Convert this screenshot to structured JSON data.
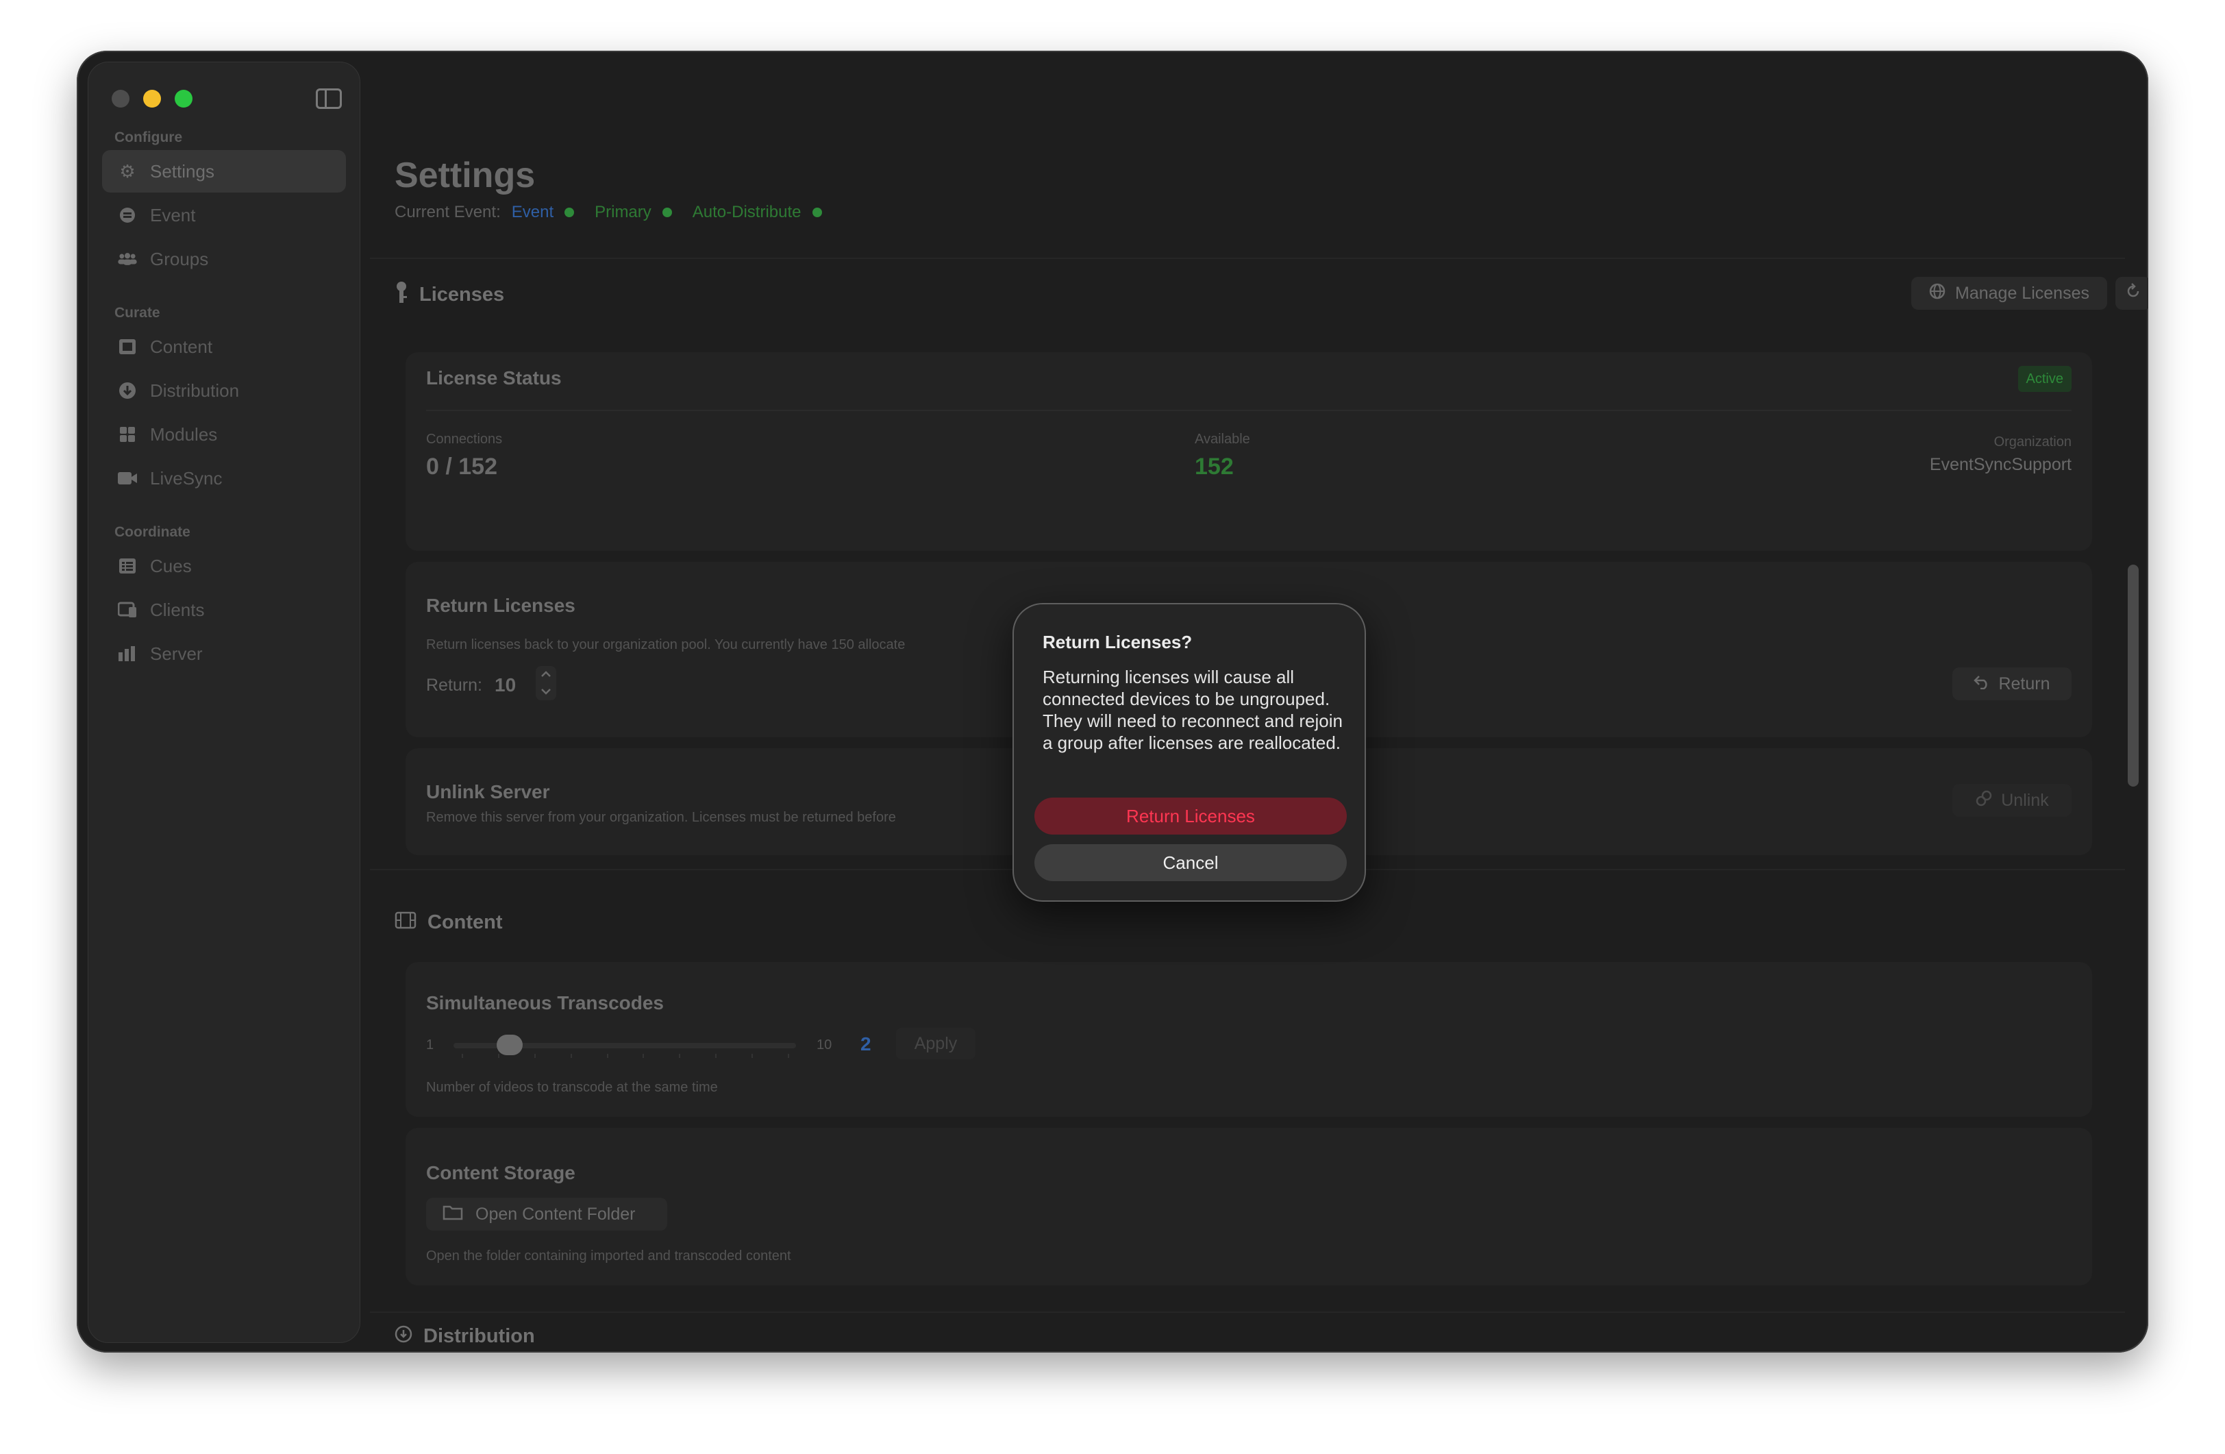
{
  "sidebar": {
    "sections": [
      {
        "label": "Configure",
        "items": [
          {
            "label": "Settings",
            "icon": "gear-icon",
            "active": true
          },
          {
            "label": "Event",
            "icon": "event-icon"
          },
          {
            "label": "Groups",
            "icon": "groups-icon"
          }
        ]
      },
      {
        "label": "Curate",
        "items": [
          {
            "label": "Content",
            "icon": "content-icon"
          },
          {
            "label": "Distribution",
            "icon": "distribution-icon"
          },
          {
            "label": "Modules",
            "icon": "modules-icon"
          },
          {
            "label": "LiveSync",
            "icon": "camera-icon"
          }
        ]
      },
      {
        "label": "Coordinate",
        "items": [
          {
            "label": "Cues",
            "icon": "cues-icon"
          },
          {
            "label": "Clients",
            "icon": "clients-icon"
          },
          {
            "label": "Server",
            "icon": "server-icon"
          }
        ]
      }
    ]
  },
  "header": {
    "title": "Settings",
    "current_event_label": "Current Event:",
    "event_name": "Event",
    "role": "Primary",
    "mode": "Auto-Distribute"
  },
  "licenses": {
    "heading": "Licenses",
    "manage_label": "Manage Licenses",
    "status": {
      "title": "License Status",
      "badge": "Active",
      "connections_label": "Connections",
      "connections_value": "0 / 152",
      "available_label": "Available",
      "available_value": "152",
      "organization_label": "Organization",
      "organization_value": "EventSyncSupport"
    },
    "return": {
      "title": "Return Licenses",
      "description": "Return licenses back to your organization pool. You currently have 150 allocate",
      "return_label": "Return:",
      "return_value": "10",
      "button_label": "Return"
    },
    "unlink": {
      "title": "Unlink Server",
      "description": "Remove this server from your organization. Licenses must be returned before",
      "button_label": "Unlink"
    }
  },
  "content": {
    "heading": "Content",
    "transcodes": {
      "title": "Simultaneous Transcodes",
      "min_label": "1",
      "max_label": "10",
      "value": "2",
      "apply_label": "Apply",
      "description": "Number of videos to transcode at the same time"
    },
    "storage": {
      "title": "Content Storage",
      "button_label": "Open Content Folder",
      "description": "Open the folder containing imported and transcoded content"
    }
  },
  "distribution": {
    "heading": "Distribution"
  },
  "dialog": {
    "title": "Return Licenses?",
    "message": "Returning licenses will cause all connected devices to be ungrouped. They will need to reconnect and rejoin a group after licenses are reallocated.",
    "confirm_label": "Return Licenses",
    "cancel_label": "Cancel"
  },
  "colors": {
    "event_blue": "#2f5fa5",
    "status_green": "#2e8b3a",
    "destructive_red": "#ff3652"
  }
}
